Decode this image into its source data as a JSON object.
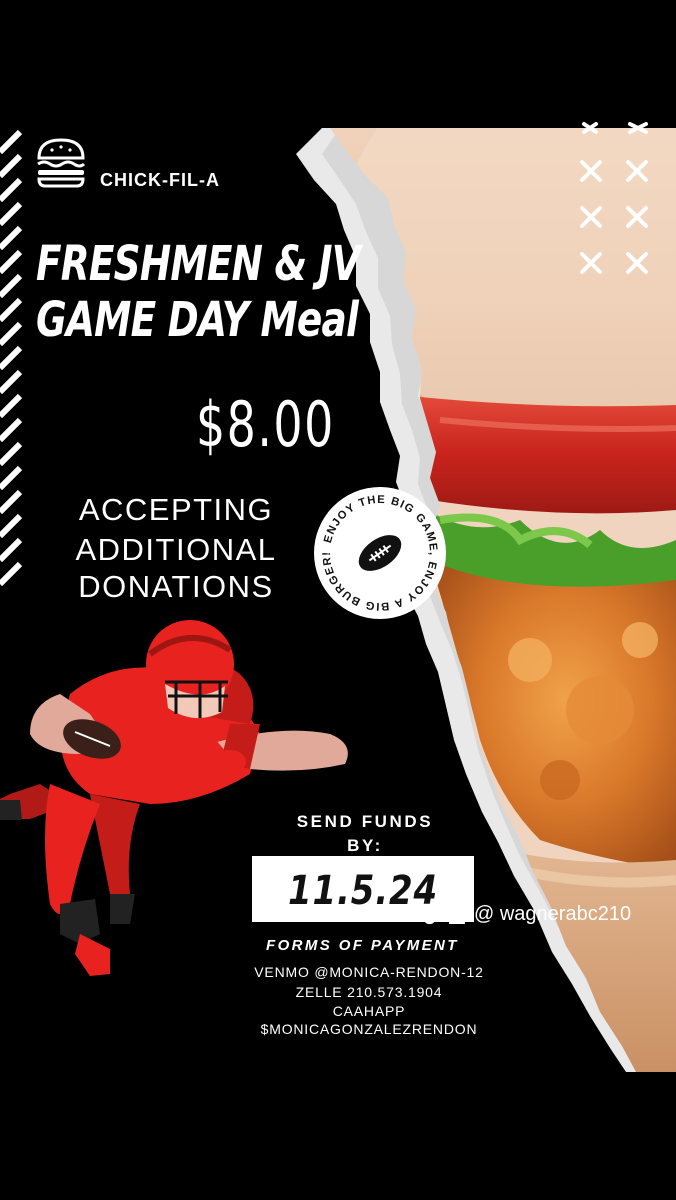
{
  "brand": {
    "name": "CHICK-FIL-A",
    "logo_icon": "burger-icon"
  },
  "headline": {
    "line1": "FRESHMEN & JV",
    "line2": "GAME DAY Meal"
  },
  "price": "$8.00",
  "donations": {
    "line1": "ACCEPTING",
    "line2": "ADDITIONAL",
    "line3": "DONATIONS"
  },
  "badge": {
    "text": "ENJOY THE BIG GAME, ENJOY A BIG BURGER!",
    "icon": "football-icon"
  },
  "deadline": {
    "label_line1": "SEND FUNDS",
    "label_line2": "BY:",
    "date": "11.5.24"
  },
  "payment": {
    "heading": "FORMS OF PAYMENT",
    "venmo": "VENMO @MONICA-RENDON-12",
    "zelle": "ZELLE 210.573.1904",
    "cashapp_label": "CAAHAPP",
    "cashapp_handle": "$MONICAGONZALEZRENDON"
  },
  "watermark": {
    "handle": "@ wagnerabc210",
    "icons": [
      "tiktok-icon",
      "user-icon"
    ]
  },
  "colors": {
    "background": "#000000",
    "accent_red": "#e8231f",
    "text": "#ffffff"
  }
}
